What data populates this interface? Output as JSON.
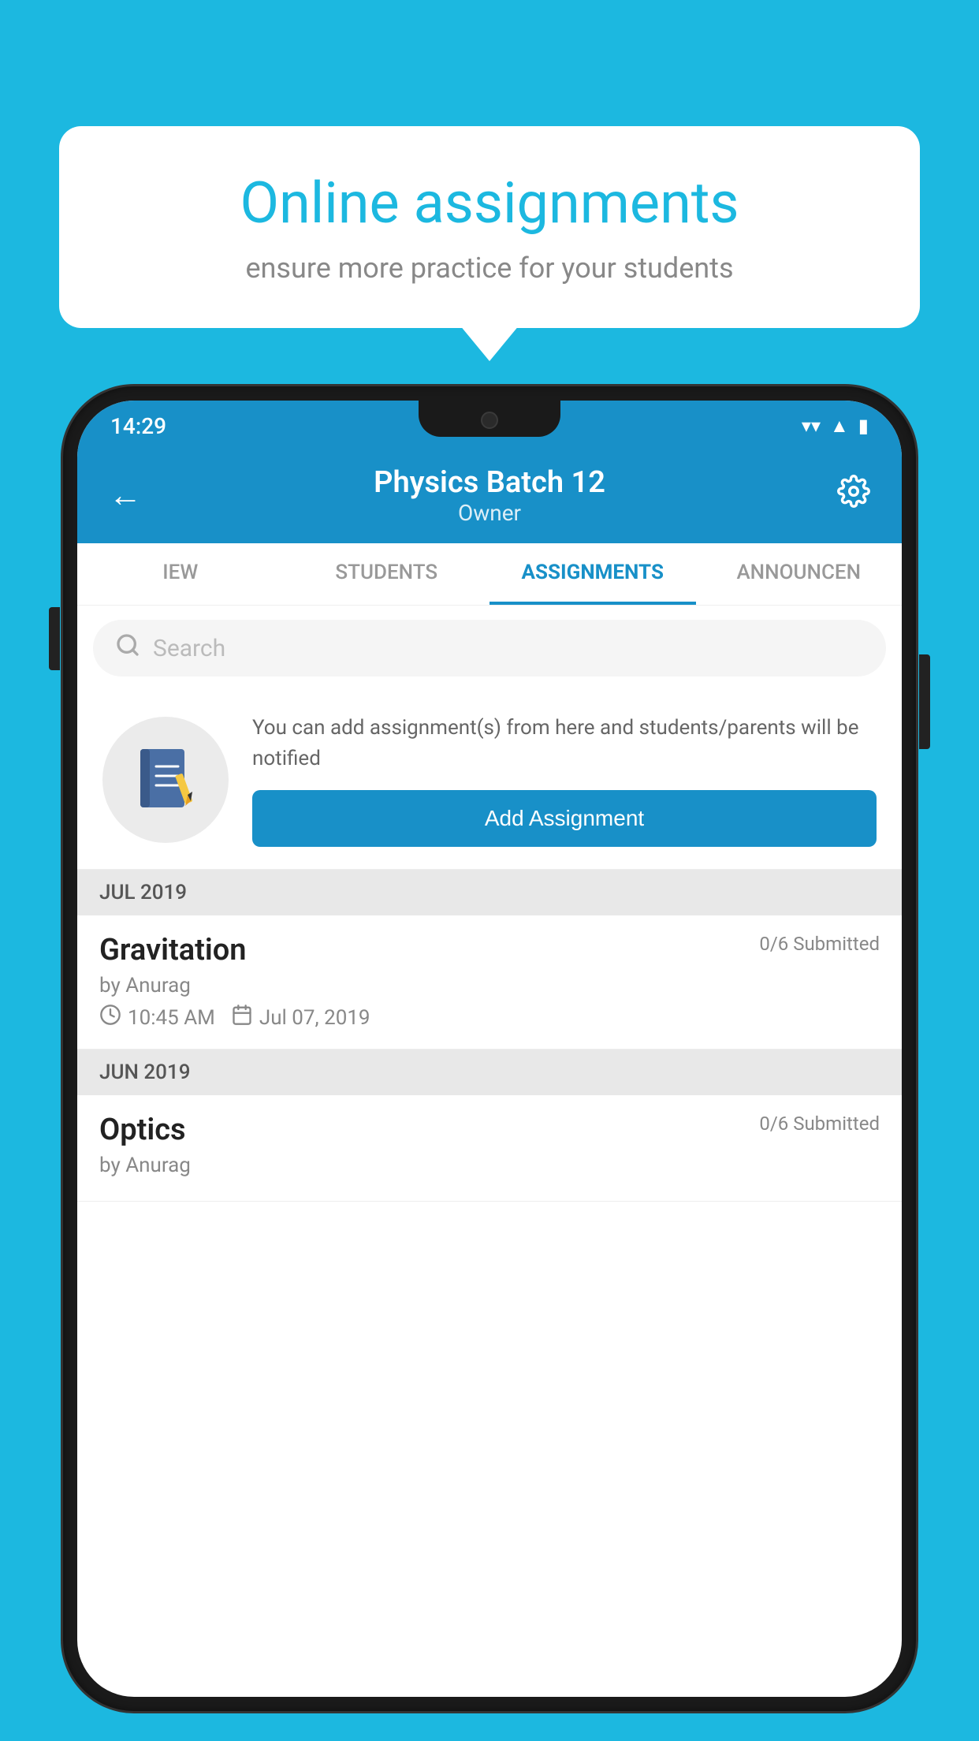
{
  "background_color": "#1cb8e0",
  "speech_bubble": {
    "title": "Online assignments",
    "subtitle": "ensure more practice for your students"
  },
  "phone": {
    "status_bar": {
      "time": "14:29",
      "icons": [
        "wifi",
        "signal",
        "battery"
      ]
    },
    "header": {
      "back_label": "←",
      "title": "Physics Batch 12",
      "subtitle": "Owner",
      "settings_label": "⚙"
    },
    "tabs": [
      {
        "label": "IEW",
        "active": false
      },
      {
        "label": "STUDENTS",
        "active": false
      },
      {
        "label": "ASSIGNMENTS",
        "active": true
      },
      {
        "label": "ANNOUNCEN",
        "active": false
      }
    ],
    "search": {
      "placeholder": "Search"
    },
    "promo": {
      "text": "You can add assignment(s) from here and students/parents will be notified",
      "button_label": "Add Assignment"
    },
    "sections": [
      {
        "header": "JUL 2019",
        "assignments": [
          {
            "name": "Gravitation",
            "submitted": "0/6 Submitted",
            "author": "by Anurag",
            "time": "10:45 AM",
            "date": "Jul 07, 2019"
          }
        ]
      },
      {
        "header": "JUN 2019",
        "assignments": [
          {
            "name": "Optics",
            "submitted": "0/6 Submitted",
            "author": "by Anurag",
            "time": "",
            "date": ""
          }
        ]
      }
    ]
  }
}
